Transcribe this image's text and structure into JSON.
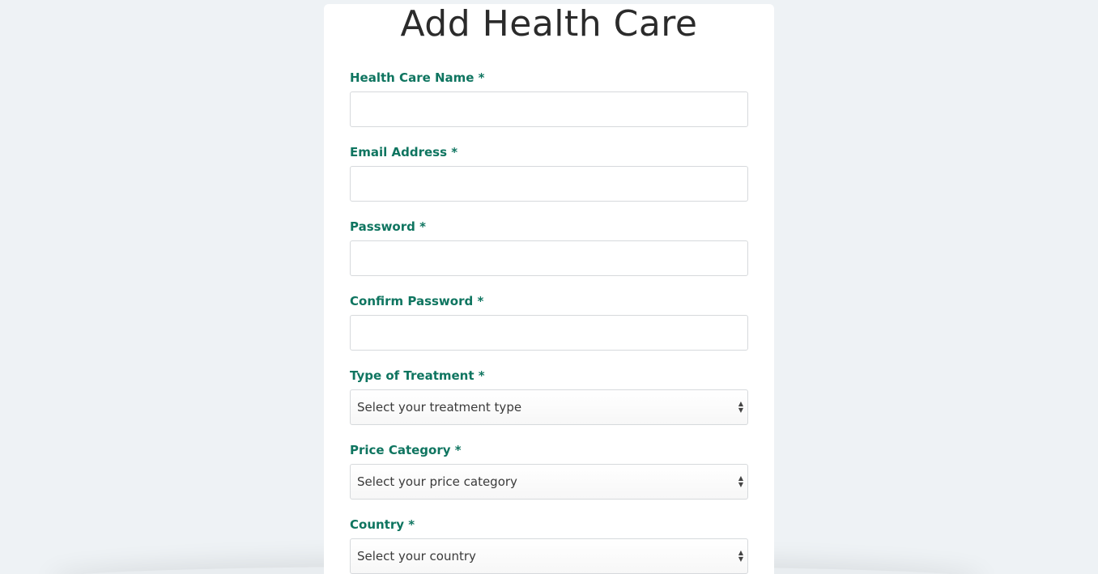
{
  "form": {
    "title": "Add Health Care",
    "fields": [
      {
        "label": "Health Care Name *",
        "type": "text",
        "value": ""
      },
      {
        "label": "Email Address *",
        "type": "text",
        "value": ""
      },
      {
        "label": "Password *",
        "type": "password",
        "value": ""
      },
      {
        "label": "Confirm Password *",
        "type": "password",
        "value": ""
      },
      {
        "label": "Type of Treatment *",
        "type": "select",
        "value": "Select your treatment type"
      },
      {
        "label": "Price Category *",
        "type": "select",
        "value": "Select your price category"
      },
      {
        "label": "Country *",
        "type": "select",
        "value": "Select your country"
      }
    ]
  },
  "icons": {
    "select_arrows": "up-down-arrows-icon"
  },
  "colors": {
    "label": "#0f7560",
    "background": "#eef2f5",
    "card": "#ffffff"
  }
}
